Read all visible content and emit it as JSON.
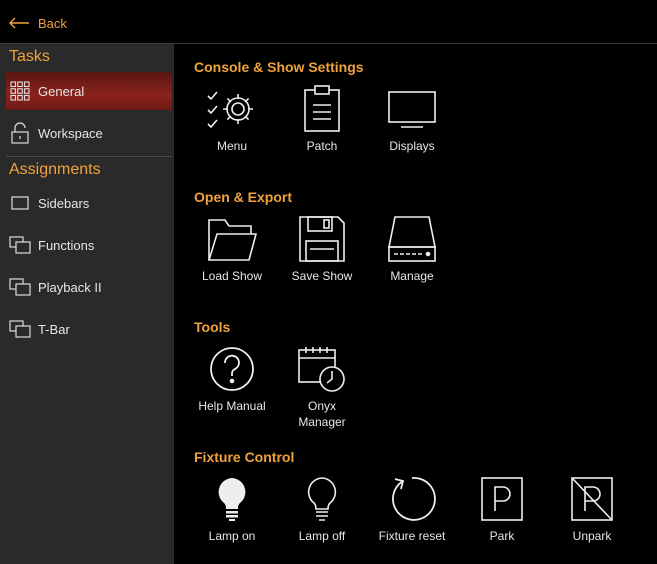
{
  "header": {
    "back_label": "Back"
  },
  "sidebar": {
    "tasks_title": "Tasks",
    "tasks": [
      {
        "label": "General",
        "icon": "grid-icon",
        "active": true
      },
      {
        "label": "Workspace",
        "icon": "lock-icon",
        "active": false
      }
    ],
    "assignments_title": "Assignments",
    "assignments": [
      {
        "label": "Sidebars",
        "icon": "rectangle-icon"
      },
      {
        "label": "Functions",
        "icon": "windows-icon"
      },
      {
        "label": "Playback II",
        "icon": "windows-icon"
      },
      {
        "label": "T-Bar",
        "icon": "windows-icon"
      }
    ]
  },
  "main": {
    "groups": [
      {
        "title": "Console & Show Settings",
        "tiles": [
          {
            "label": "Menu",
            "icon": "checklist-gear-icon"
          },
          {
            "label": "Patch",
            "icon": "clipboard-icon"
          },
          {
            "label": "Displays",
            "icon": "monitor-icon"
          }
        ]
      },
      {
        "title": "Open & Export",
        "tiles": [
          {
            "label": "Load Show",
            "icon": "folder-icon"
          },
          {
            "label": "Save Show",
            "icon": "floppy-disk-icon"
          },
          {
            "label": "Manage",
            "icon": "drive-icon"
          }
        ]
      },
      {
        "title": "Tools",
        "tiles": [
          {
            "label": "Help Manual",
            "icon": "question-icon"
          },
          {
            "label": "Onyx\nManager",
            "icon": "calendar-clock-icon"
          }
        ]
      },
      {
        "title": "Fixture Control",
        "tiles": [
          {
            "label": "Lamp on",
            "icon": "bulb-on-icon"
          },
          {
            "label": "Lamp off",
            "icon": "bulb-off-icon"
          },
          {
            "label": "Fixture reset",
            "icon": "reset-icon"
          },
          {
            "label": "Park",
            "icon": "park-icon"
          },
          {
            "label": "Unpark",
            "icon": "unpark-icon"
          }
        ]
      }
    ]
  },
  "colors": {
    "accent": "#f0a23c",
    "active_item": "#8a221c",
    "sidebar_bg": "#2a2a2a"
  }
}
